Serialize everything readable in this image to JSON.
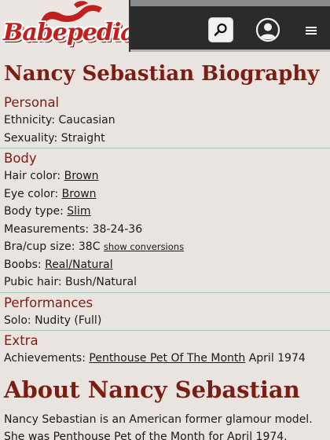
{
  "header": {
    "logo_text": "Babepedia",
    "search_icon": "search-icon",
    "user_icon": "user-icon",
    "menu_glyph": "≡"
  },
  "page_title": "Nancy Sebastian Biography",
  "personal": {
    "heading": "Personal",
    "ethnicity_label": "Ethnicity:",
    "ethnicity_value": "Caucasian",
    "sexuality_label": "Sexuality:",
    "sexuality_value": "Straight"
  },
  "body": {
    "heading": "Body",
    "hair_label": "Hair color:",
    "hair_value": "Brown",
    "eye_label": "Eye color:",
    "eye_value": "Brown",
    "type_label": "Body type:",
    "type_value": "Slim",
    "measure_label": "Measurements:",
    "measure_value": "38-24-36",
    "bra_label": "Bra/cup size:",
    "bra_value": "38C",
    "bra_link": "show conversions",
    "boobs_label": "Boobs:",
    "boobs_value": "Real/Natural",
    "pubic_label": "Pubic hair:",
    "pubic_value": "Bush/Natural"
  },
  "performances": {
    "heading": "Performances",
    "solo_label": "Solo:",
    "solo_value": "Nudity (Full)"
  },
  "extra": {
    "heading": "Extra",
    "achieve_label": "Achievements:",
    "achieve_link": "Penthouse Pet Of The Month",
    "achieve_suffix": "April 1974"
  },
  "about": {
    "title": "About Nancy Sebastian",
    "text": "Nancy Sebastian is an American former glamour model. She was Penthouse Pet of the Month for April 1974."
  },
  "colors": {
    "accent": "#7a1e14",
    "background": "#e9e4df",
    "header": "#2b2b2b",
    "logo_red": "#c0211e"
  }
}
